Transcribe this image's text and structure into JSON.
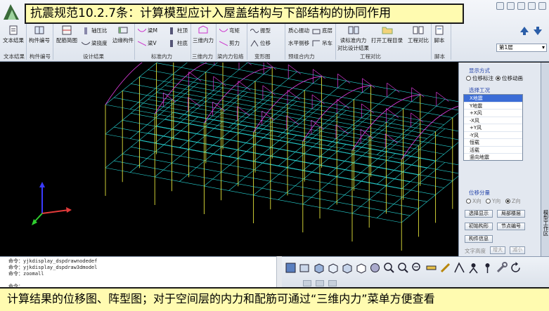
{
  "title_overlay": "抗震规范10.2.7条：计算模型应计入屋盖结构与下部结构的协同作用",
  "bottom_caption": "计算结果的位移图、阵型图；对于空间层的内力和配筋可通过“三维内力”菜单方便查看",
  "ribbon": {
    "buttons": {
      "text_result": "文本结果",
      "member_id": "构件编号",
      "rebar_brief": "配筋简图",
      "axial_ratio": "轴压比",
      "beam_deflection": "梁挠度",
      "edge_member": "边缘构件",
      "beam_m": "梁M",
      "beam_v": "梁V",
      "col_m": "柱顶",
      "col_bottom": "柱底",
      "three_d_force": "三维内力",
      "bending": "弯矩",
      "shear": "剪力",
      "vibration": "振型",
      "displacement": "位移",
      "max_rig_vibe": "质心振动",
      "level_disp": "水平侧移",
      "bottom": "底层",
      "crane": "吊车",
      "read_calc": "读标准内力",
      "compare_design": "对比设计结果",
      "open_project": "打开工程目录",
      "project_compare": "工程对比",
      "script": "脚本"
    },
    "groups": {
      "text_result": "文本结果",
      "member_id": "构件编号",
      "design_result": "设计结果",
      "standard_force": "标准内力",
      "three_d_force": "三维内力",
      "internal_envelope": "梁内力包络",
      "deformation": "变形图",
      "prestress_force": "预组合内力",
      "project_compare": "工程对比",
      "script": "脚本"
    },
    "floor_select": "第1层"
  },
  "right_panel": {
    "display_mode_title": "显示方式",
    "display_modes": [
      {
        "label": "位移标注",
        "selected": false
      },
      {
        "label": "位移动画",
        "selected": true
      }
    ],
    "case_title": "选择工况",
    "cases": [
      {
        "label": "X地震",
        "selected": true
      },
      {
        "label": "Y地震",
        "selected": false
      },
      {
        "label": "+X风",
        "selected": false
      },
      {
        "label": "-X风",
        "selected": false
      },
      {
        "label": "+Y风",
        "selected": false
      },
      {
        "label": "-Y风",
        "selected": false
      },
      {
        "label": "恒载",
        "selected": false
      },
      {
        "label": "活载",
        "selected": false
      },
      {
        "label": "竖向地震",
        "selected": false
      }
    ],
    "component_title": "位移分量",
    "components": [
      {
        "label": "X向",
        "selected": false
      },
      {
        "label": "Y向",
        "selected": false
      },
      {
        "label": "Z向",
        "selected": true
      }
    ],
    "buttons": {
      "select_display": "选择显示",
      "local_floor": "局部楼层",
      "initial_deform": "初始构形",
      "node_id": "节点编号",
      "member_info": "构件信息",
      "text_height": "文字高度",
      "enlarge": "增大",
      "reduce": "减小"
    },
    "side_tab": "模型工作区"
  },
  "command": {
    "lines": [
      "命令：yjkdisplay_dspdrawnodedef",
      "命令：yjkdisplay_dspdraw3dmodel",
      "命令：zoomall",
      "",
      "命令："
    ]
  },
  "colors": {
    "title_bg": "#fffbb0",
    "caption_bg": "#fffbb0",
    "wire_cyan": "#27d6d6",
    "wire_magenta": "#e23de2",
    "wire_yellow": "#e2e23a",
    "viewport_bg": "#000000"
  },
  "icons": [
    "app-logo-icon",
    "axis-triad-icon"
  ]
}
